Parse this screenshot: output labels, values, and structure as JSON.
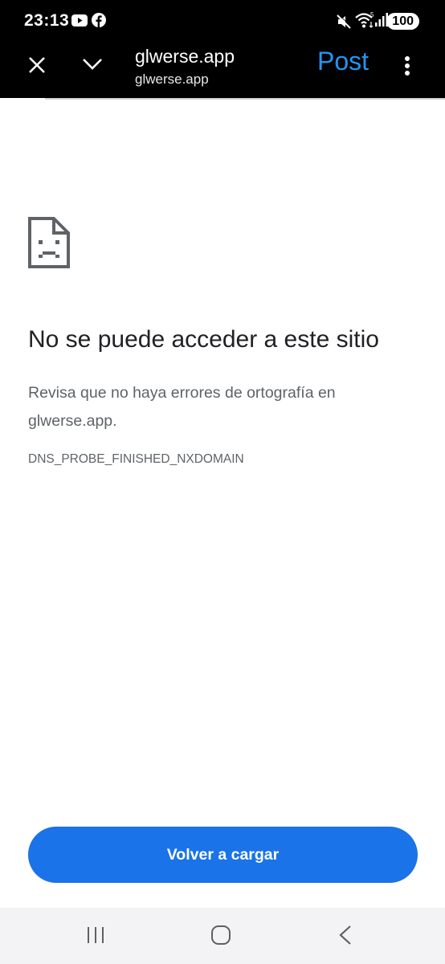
{
  "status_bar": {
    "time": "23:13",
    "left_icons": [
      "youtube-icon",
      "facebook-icon"
    ],
    "right_icons": [
      "mute-icon",
      "wifi-icon",
      "signal-icon"
    ],
    "battery": "100"
  },
  "toolbar": {
    "title": "glwerse.app",
    "subtitle": "glwerse.app",
    "post_label": "Post",
    "close_icon": "close-icon",
    "collapse_icon": "chevron-down-icon",
    "menu_icon": "more-vert-icon",
    "accent_color": "#2196f3"
  },
  "error_page": {
    "icon": "sad-page-icon",
    "title": "No se puede acceder a este sitio",
    "message": "Revisa que no haya errores de ortografía en glwerse.app.",
    "error_code": "DNS_PROBE_FINISHED_NXDOMAIN",
    "reload_label": "Volver a cargar",
    "button_color": "#1a73e8"
  },
  "nav_bar": {
    "icons": [
      "recents-icon",
      "home-icon",
      "back-icon"
    ]
  }
}
